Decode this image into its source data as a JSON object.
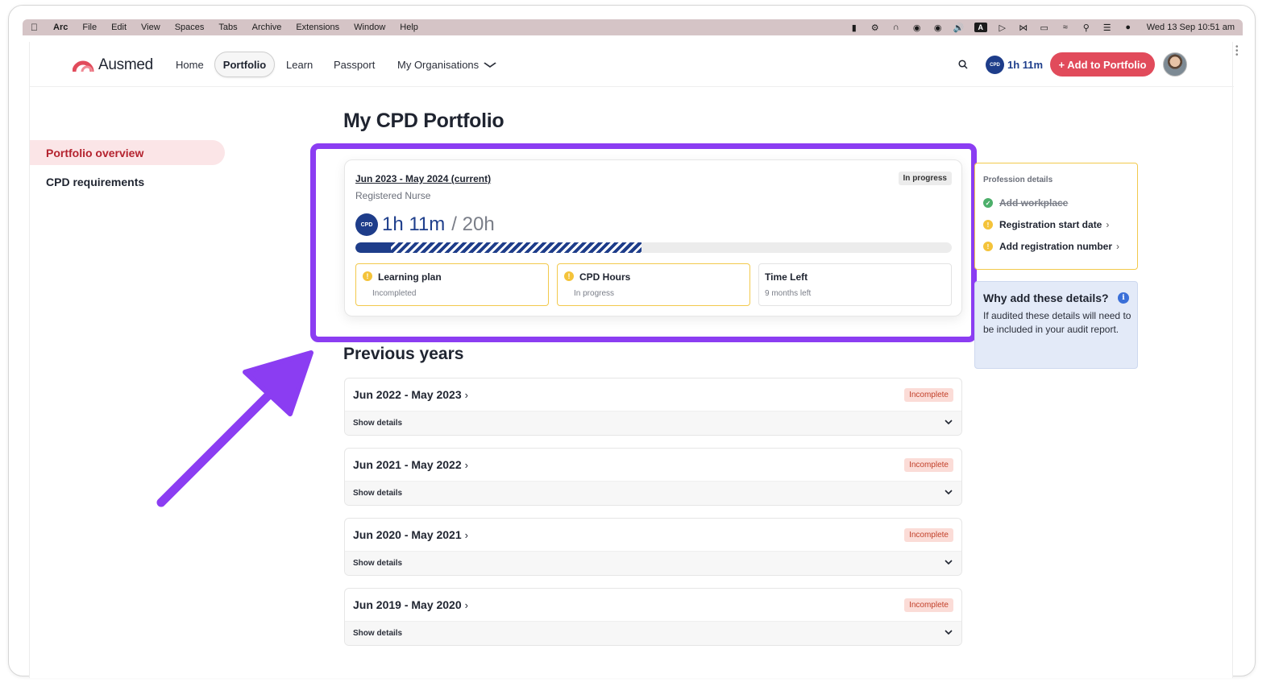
{
  "menubar": {
    "app": "Arc",
    "items": [
      "File",
      "Edit",
      "View",
      "Spaces",
      "Tabs",
      "Archive",
      "Extensions",
      "Window",
      "Help"
    ],
    "datetime": "Wed 13 Sep  10:51 am",
    "status_icons": [
      "battery-icon",
      "gear-icon",
      "tab-icon",
      "onepassword-icon",
      "grammarly-icon",
      "volume-icon",
      "input-source-icon",
      "play-icon",
      "bluetooth-icon",
      "charging-battery-icon",
      "wifi-icon",
      "search-icon",
      "control-center-icon",
      "siri-icon"
    ],
    "input_source": "A"
  },
  "nav": {
    "brand": "Ausmed",
    "links": {
      "home": "Home",
      "portfolio": "Portfolio",
      "learn": "Learn",
      "passport": "Passport",
      "orgs": "My Organisations"
    },
    "cpd_badge": "CPD",
    "cpd_hours": "1h 11m",
    "add_button": "+ Add to Portfolio",
    "accent": "#e14b5b"
  },
  "sidebar": {
    "items": [
      {
        "label": "Portfolio overview",
        "active": true
      },
      {
        "label": "CPD requirements",
        "active": false
      }
    ]
  },
  "main": {
    "title": "My CPD Portfolio",
    "current": {
      "period": "Jun 2023 - May 2024 (current)",
      "role": "Registered Nurse",
      "status": "In progress",
      "badge": "CPD",
      "hours": "1h 11m",
      "target": "/ 20h",
      "progress_fraction": 0.48,
      "progress_solid_fraction": 0.06,
      "stats": [
        {
          "title": "Learning plan",
          "sub": "Incompleted",
          "state": "warn"
        },
        {
          "title": "CPD Hours",
          "sub": "In progress",
          "state": "warn"
        },
        {
          "title": "Time Left",
          "sub": "9 months left",
          "state": "neutral"
        }
      ]
    },
    "previous_title": "Previous years",
    "previous": [
      {
        "period": "Jun 2022 - May 2023",
        "status": "Incomplete",
        "details": "Show details"
      },
      {
        "period": "Jun 2021 - May 2022",
        "status": "Incomplete",
        "details": "Show details"
      },
      {
        "period": "Jun 2020 - May 2021",
        "status": "Incomplete",
        "details": "Show details"
      },
      {
        "period": "Jun 2019 - May 2020",
        "status": "Incomplete",
        "details": "Show details"
      }
    ]
  },
  "profession": {
    "title": "Profession details",
    "items": [
      {
        "label": "Add workplace",
        "done": true
      },
      {
        "label": "Registration start date",
        "done": false
      },
      {
        "label": "Add registration number",
        "done": false
      }
    ]
  },
  "why": {
    "title": "Why add these details?",
    "body": "If audited these details will need to be included in your audit report."
  },
  "colors": {
    "highlight": "#8b3df2",
    "brand_blue": "#1e3d8a",
    "warning": "#f4c33a",
    "incomplete_bg": "#fbdcd7",
    "incomplete_text": "#c2402a"
  }
}
